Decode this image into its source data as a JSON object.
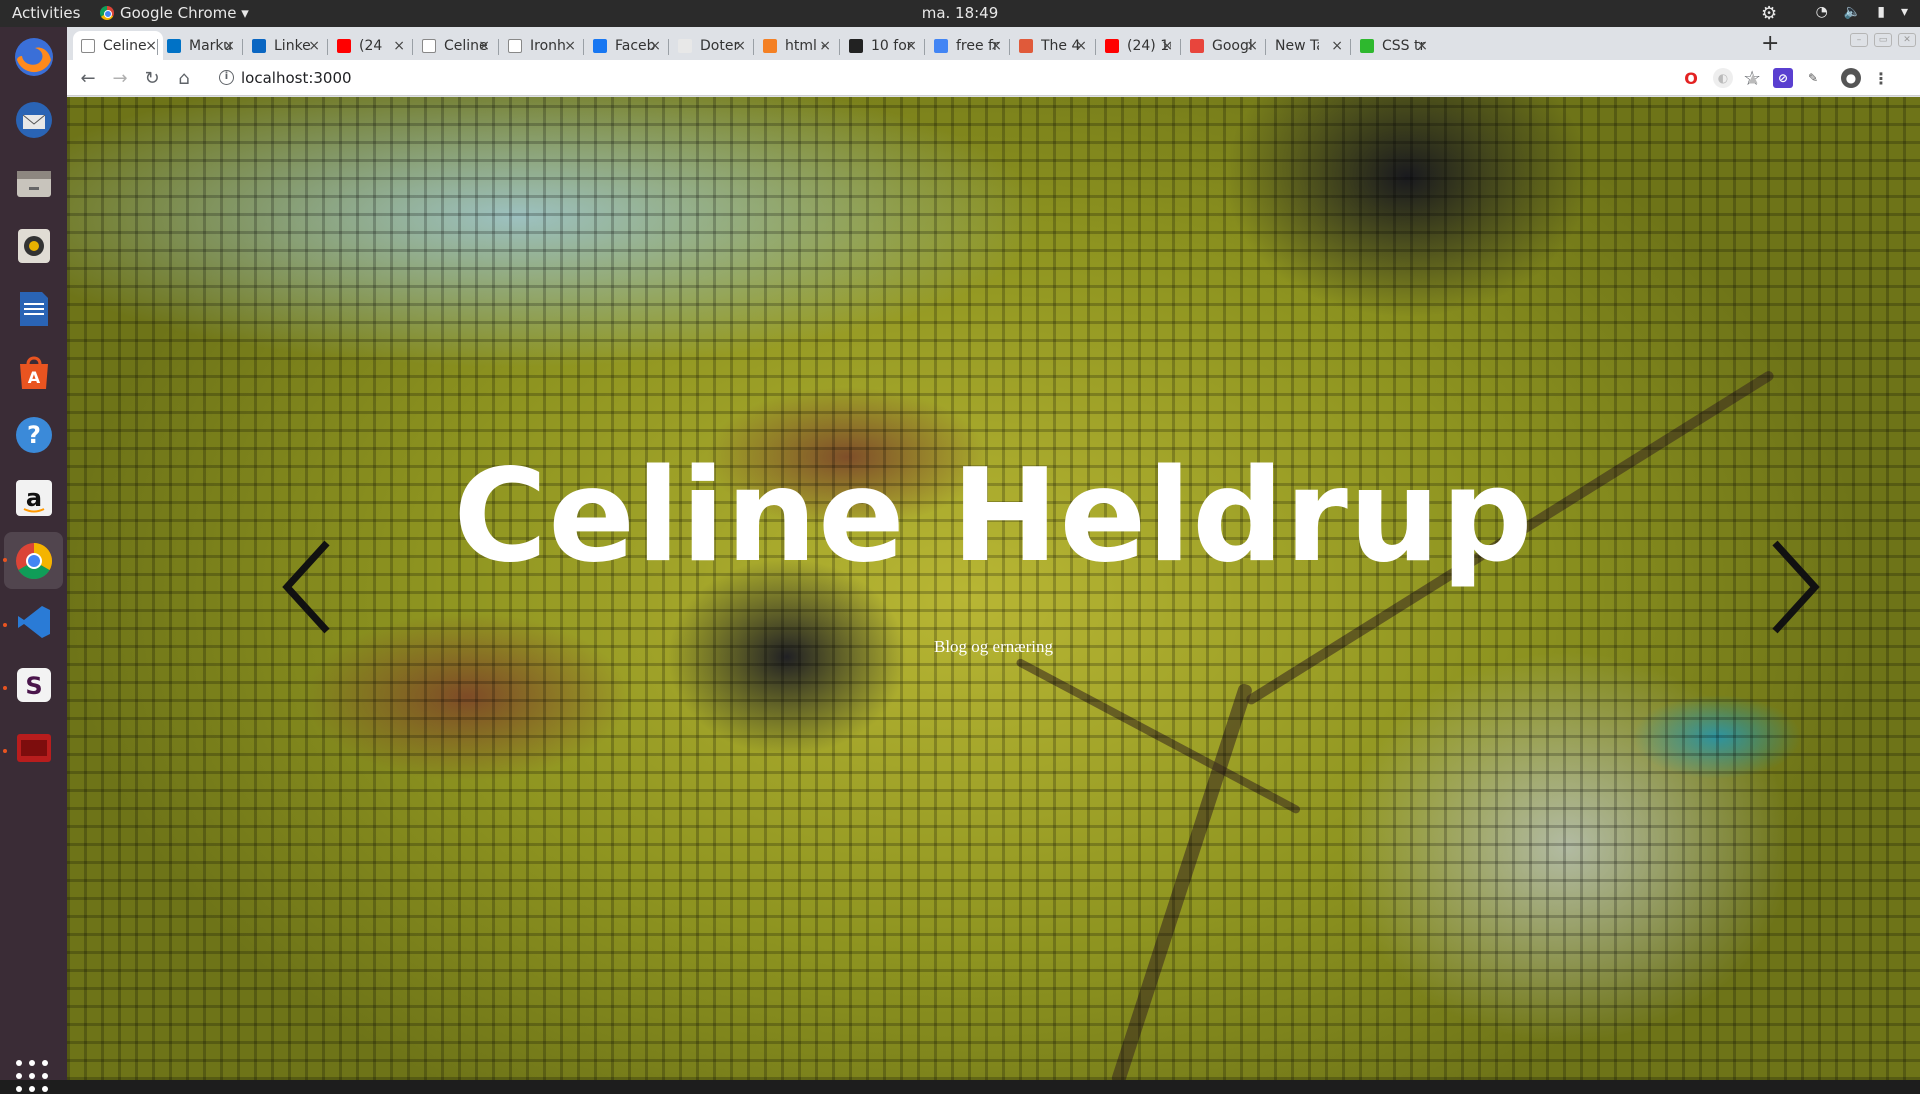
{
  "topbar": {
    "activities": "Activities",
    "app_name": "Google Chrome ▾",
    "clock": "ma. 18:49",
    "tray": [
      "wifi",
      "volume",
      "battery"
    ]
  },
  "dock": {
    "apps": [
      "firefox",
      "thunderbird",
      "files",
      "rhythmbox",
      "writer",
      "software-center",
      "help",
      "amazon",
      "chrome",
      "vscode",
      "slack",
      "terminal-app"
    ],
    "show_apps_icon": "grid-icon"
  },
  "browser": {
    "tabs": [
      {
        "label": "Celine",
        "favicon": "doc",
        "color": "#ffffff"
      },
      {
        "label": "Marku",
        "favicon": "outlook",
        "color": "#0072c6"
      },
      {
        "label": "Linke",
        "favicon": "linkedin",
        "color": "#0a66c2"
      },
      {
        "label": "(24",
        "favicon": "youtube",
        "color": "#ff0000"
      },
      {
        "label": "Celine",
        "favicon": "x",
        "color": "#ffffff"
      },
      {
        "label": "Ironh",
        "favicon": "doc",
        "color": "#ffffff"
      },
      {
        "label": "Faceb",
        "favicon": "facebook",
        "color": "#1877f2"
      },
      {
        "label": "Doter",
        "favicon": "doterra",
        "color": "#e8e8e8"
      },
      {
        "label": "html -",
        "favicon": "stackoverflow",
        "color": "#f48024"
      },
      {
        "label": "10 for",
        "favicon": "d",
        "color": "#222222"
      },
      {
        "label": "free fr",
        "favicon": "google",
        "color": "#4285f4"
      },
      {
        "label": "The 4",
        "favicon": "medium",
        "color": "#e05a3a"
      },
      {
        "label": "(24) 1(",
        "favicon": "youtube",
        "color": "#ff0000"
      },
      {
        "label": "Googl",
        "favicon": "f-red",
        "color": "#e8453c"
      },
      {
        "label": "New Tab",
        "favicon": "",
        "color": ""
      },
      {
        "label": "CSS tr",
        "favicon": "css",
        "color": "#2eb82e"
      }
    ],
    "url": "localhost:3000"
  },
  "page": {
    "title": "Celine Heldrup",
    "subtitle": "Blog og ernæring",
    "prev_arrow": "‹",
    "next_arrow": "›"
  }
}
